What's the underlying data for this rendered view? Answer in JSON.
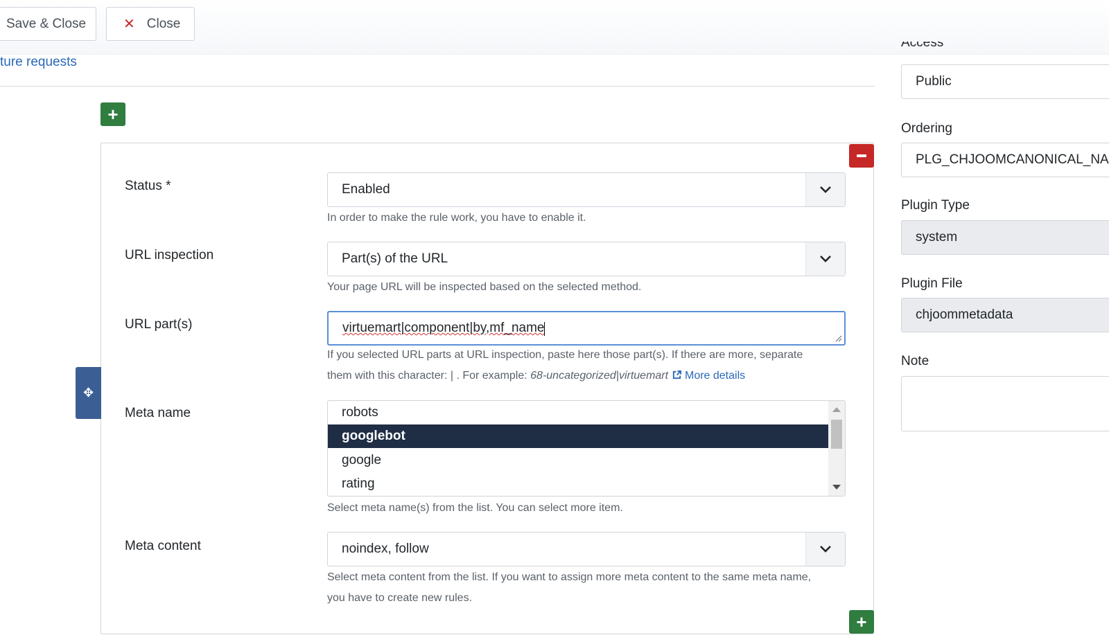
{
  "toolbar": {
    "save_close_label": "Save & Close",
    "close_label": "Close"
  },
  "top_link": "ture requests",
  "form": {
    "status": {
      "label": "Status *",
      "value": "Enabled",
      "help": "In order to make the rule work, you have to enable it."
    },
    "url_inspection": {
      "label": "URL inspection",
      "value": "Part(s) of the URL",
      "help": "Your page URL will be inspected based on the selected method."
    },
    "url_parts": {
      "label": "URL part(s)",
      "value": "virtuemart|component|by,mf_name",
      "help_line1": "If you selected URL parts at URL inspection, paste here those part(s). If there are more, separate",
      "help_line2_prefix": "them with this character: | . For example: ",
      "help_example": "68-uncategorized|virtuemart",
      "help_link": "More details"
    },
    "meta_name": {
      "label": "Meta name",
      "options": [
        "robots",
        "googlebot",
        "google",
        "rating"
      ],
      "selected": "googlebot",
      "help": "Select meta name(s) from the list. You can select more item."
    },
    "meta_content": {
      "label": "Meta content",
      "value": "noindex, follow",
      "help_line1": "Select meta content from the list. If you want to assign more meta content to the same meta name,",
      "help_line2": "you have to create new rules."
    }
  },
  "sidebar": {
    "access_label": "Access",
    "access_value": "Public",
    "ordering_label": "Ordering",
    "ordering_value": "PLG_CHJOOMCANONICAL_NAME",
    "plugin_type_label": "Plugin Type",
    "plugin_type_value": "system",
    "plugin_file_label": "Plugin File",
    "plugin_file_value": "chjoommetadata",
    "note_label": "Note",
    "note_value": ""
  },
  "colors": {
    "add_button": "#2f7d3f",
    "remove_button": "#c52827",
    "drag_handle": "#3b5f95",
    "selected_option": "#1f2d45",
    "link": "#2a69b8"
  }
}
